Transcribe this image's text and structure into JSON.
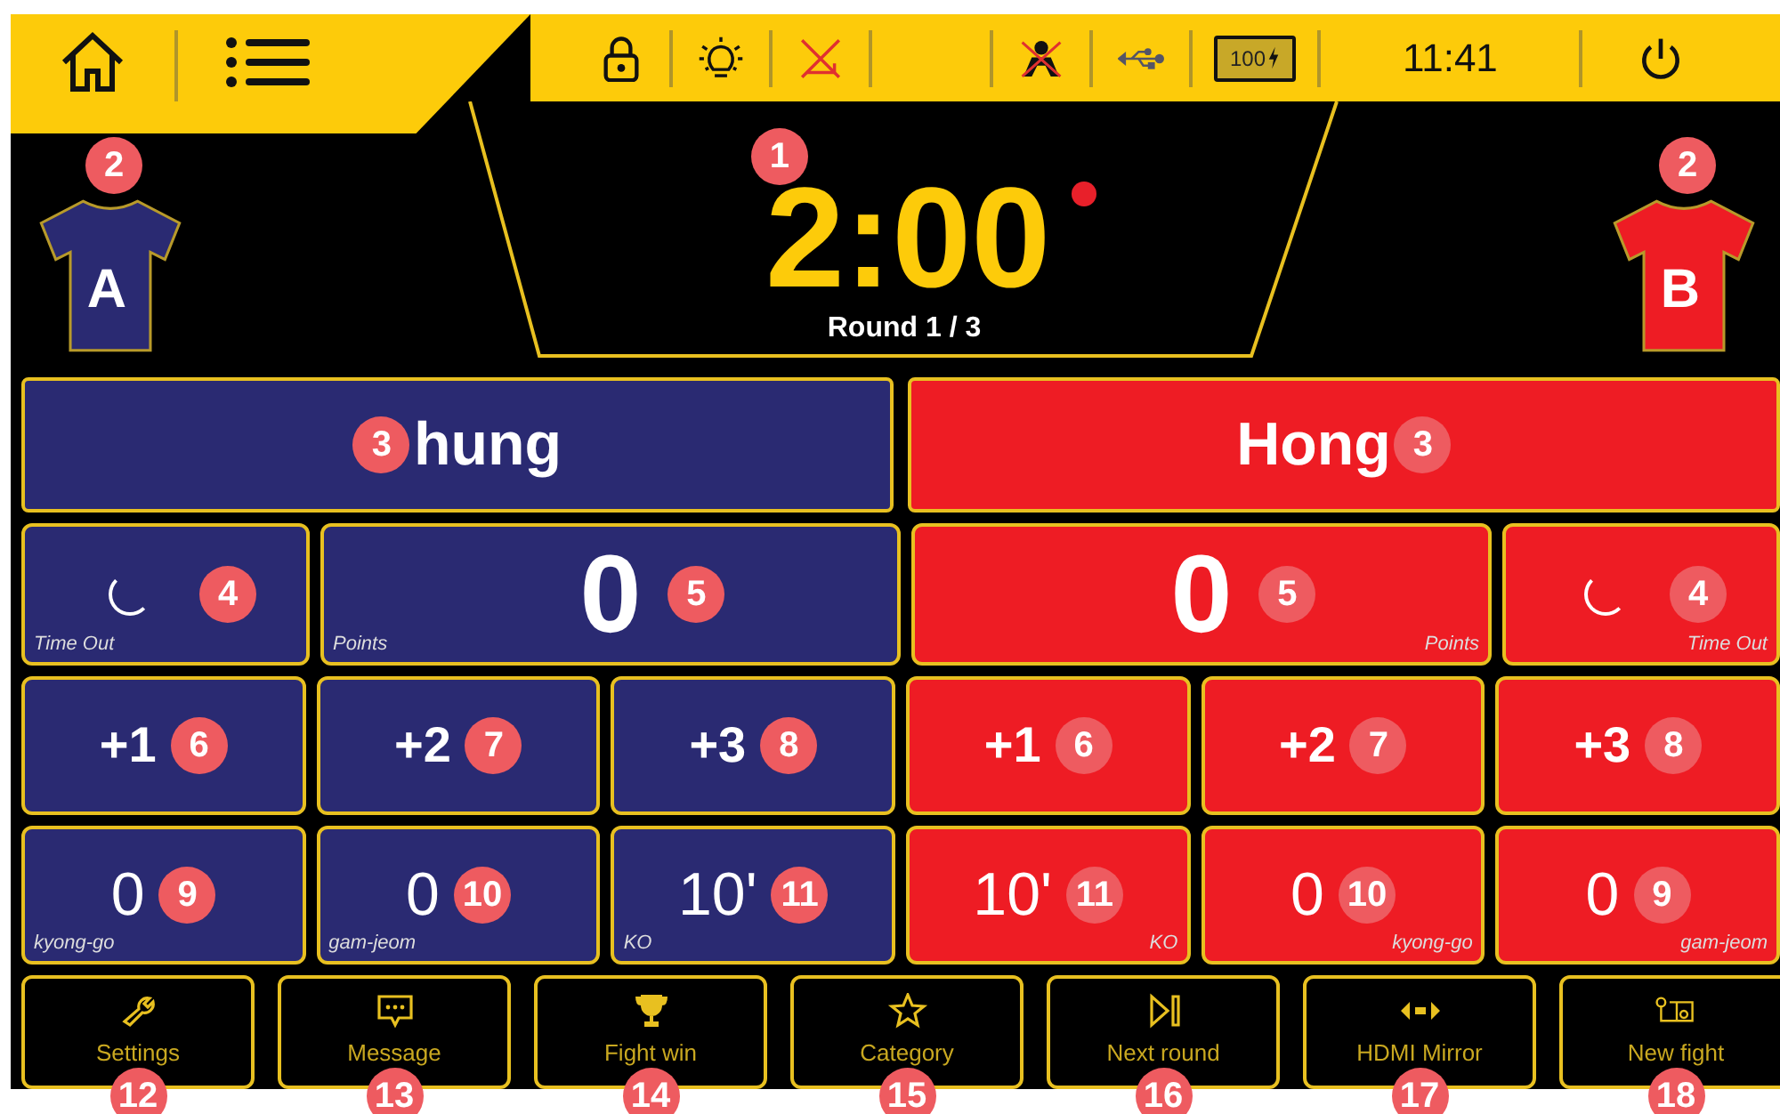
{
  "status_bar": {
    "battery_label": "100",
    "clock": "11:41"
  },
  "timer": {
    "time": "2:00",
    "round": "Round 1 / 3",
    "callout": "1"
  },
  "players": [
    {
      "mirrored": false,
      "color": "#2a2a72",
      "shirt_letter": "A",
      "shirt_callout": "2",
      "name": "hung",
      "name_callout": "3",
      "timeout": {
        "label": "Time Out",
        "callout": "4"
      },
      "points": {
        "value": "0",
        "label": "Points",
        "callout": "5"
      },
      "score_buttons": [
        {
          "label": "+1",
          "callout": "6"
        },
        {
          "label": "+2",
          "callout": "7"
        },
        {
          "label": "+3",
          "callout": "8"
        }
      ],
      "penalties": [
        {
          "value": "0",
          "label": "kyong-go",
          "callout": "9"
        },
        {
          "value": "0",
          "label": "gam-jeom",
          "callout": "10"
        },
        {
          "value": "10'",
          "label": "KO",
          "callout": "11"
        }
      ]
    },
    {
      "mirrored": true,
      "color": "#ee1c24",
      "shirt_letter": "B",
      "shirt_callout": "2",
      "name": "Hong",
      "name_callout": "3",
      "timeout": {
        "label": "Time Out",
        "callout": "4"
      },
      "points": {
        "value": "0",
        "label": "Points",
        "callout": "5"
      },
      "score_buttons": [
        {
          "label": "+1",
          "callout": "6"
        },
        {
          "label": "+2",
          "callout": "7"
        },
        {
          "label": "+3",
          "callout": "8"
        }
      ],
      "penalties": [
        {
          "value": "10'",
          "label": "KO",
          "callout": "11"
        },
        {
          "value": "0",
          "label": "kyong-go",
          "callout": "10"
        },
        {
          "value": "0",
          "label": "gam-jeom",
          "callout": "9"
        }
      ]
    }
  ],
  "actions": [
    {
      "label": "Settings",
      "callout": "12"
    },
    {
      "label": "Message",
      "callout": "13"
    },
    {
      "label": "Fight win",
      "callout": "14"
    },
    {
      "label": "Category",
      "callout": "15"
    },
    {
      "label": "Next round",
      "callout": "16"
    },
    {
      "label": "HDMI Mirror",
      "callout": "17"
    },
    {
      "label": "New fight",
      "callout": "18"
    }
  ]
}
